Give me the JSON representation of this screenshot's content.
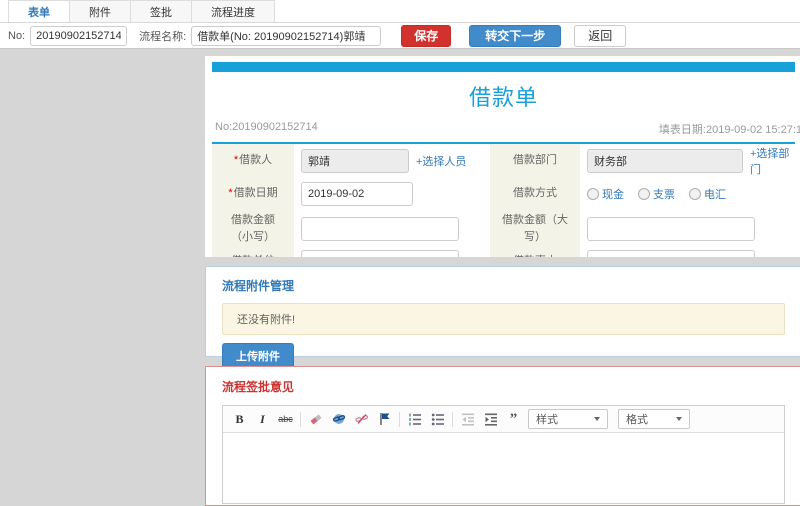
{
  "tabs": [
    {
      "label": "表单",
      "active": true
    },
    {
      "label": "附件",
      "active": false
    },
    {
      "label": "签批",
      "active": false
    },
    {
      "label": "流程进度",
      "active": false
    }
  ],
  "toolbar": {
    "no_label": "No:",
    "no_value": "20190902152714",
    "name_label": "流程名称:",
    "name_value": "借款单(No: 20190902152714)郭靖",
    "save_label": "保存",
    "forward_label": "转交下一步",
    "back_label": "返回"
  },
  "form": {
    "title": "借款单",
    "no_text": "No:20190902152714",
    "date_text": "填表日期:2019-09-02 15:27:1",
    "required_mark": "*",
    "fields": {
      "borrower": {
        "label": "借款人",
        "value": "郭靖",
        "action": "+选择人员"
      },
      "department": {
        "label": "借款部门",
        "value": "财务部",
        "action": "+选择部门"
      },
      "date": {
        "label": "借款日期",
        "value": "2019-09-02"
      },
      "method": {
        "label": "借款方式",
        "options": [
          "现金",
          "支票",
          "电汇"
        ]
      },
      "amount_small": {
        "label": "借款金额（小写）",
        "value": ""
      },
      "amount_big": {
        "label": "借款金额（大写）",
        "value": ""
      },
      "unit": {
        "label": "借款单位",
        "value": ""
      },
      "reason": {
        "label": "借款事由",
        "value": ""
      }
    }
  },
  "attachments": {
    "title": "流程附件管理",
    "empty_text": "还没有附件!",
    "upload_label": "上传附件"
  },
  "signature": {
    "title": "流程签批意见",
    "editor": {
      "bold_label": "B",
      "italic_label": "I",
      "strike_label": "abc",
      "quote_label": "”",
      "styles_label": "样式",
      "format_label": "格式"
    }
  },
  "colors": {
    "accent_cyan": "#18a0d8",
    "link_blue": "#337ab7",
    "primary_button_blue": "#428bca",
    "save_button_red": "#d2322d",
    "section_title_red": "#cc3333",
    "label_bg_beige": "#f4f3e7",
    "alert_bg_beige": "#fbf6e3",
    "page_bg_gray": "#d6d6d6"
  }
}
